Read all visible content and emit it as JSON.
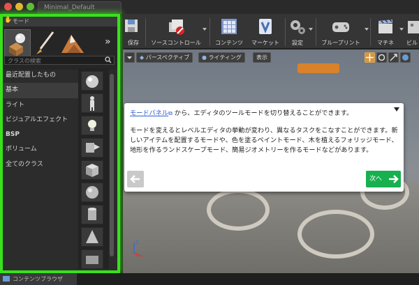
{
  "window": {
    "doc_tab": "Minimal_Default"
  },
  "modes_panel": {
    "tab_label": "モード",
    "search_placeholder": "クラスの検索",
    "more_glyph": "»",
    "categories": [
      {
        "label": "最近配置したもの"
      },
      {
        "label": "基本"
      },
      {
        "label": "ライト"
      },
      {
        "label": "ビジュアルエフェクト"
      },
      {
        "label": "BSP"
      },
      {
        "label": "ボリューム"
      },
      {
        "label": "全てのクラス"
      }
    ]
  },
  "toolbar": {
    "items": [
      {
        "label": "保存",
        "icon": "save-icon"
      },
      {
        "label": "ソースコントロール",
        "icon": "source-control-icon"
      },
      {
        "label": "コンテンツ",
        "icon": "content-icon"
      },
      {
        "label": "マーケット",
        "icon": "marketplace-icon"
      },
      {
        "label": "設定",
        "icon": "settings-icon"
      },
      {
        "label": "ブループリント",
        "icon": "blueprint-icon"
      },
      {
        "label": "マチネ",
        "icon": "matinee-icon"
      },
      {
        "label": "ビル",
        "icon": "build-icon"
      }
    ]
  },
  "viewport": {
    "perspective_label": "パースペクティブ",
    "lighting_label": "ライティング",
    "show_label": "表示"
  },
  "tutorial": {
    "link_text": "モードパネル",
    "line1_rest": "から、エディタのツールモードを切り替えることができます。",
    "body": "モードを変えるとレベルエディタの挙動が変わり、異なるタスクをこなすことができます。新しいアイテムを配置するモードや、色を塗るペイントモード、木を植えるフォリッジモード、地形を作るランドスケープモード、簡易ジオメトリーを作るモードなどがあります。",
    "next_label": "次へ"
  },
  "axis": {
    "z": "Z",
    "x": "X"
  },
  "bottom": {
    "content_browser_tab": "コンテンツブラウザ"
  },
  "colors": {
    "highlight_green": "#38e21b",
    "next_button": "#18b04f",
    "link": "#2f5fcf"
  }
}
